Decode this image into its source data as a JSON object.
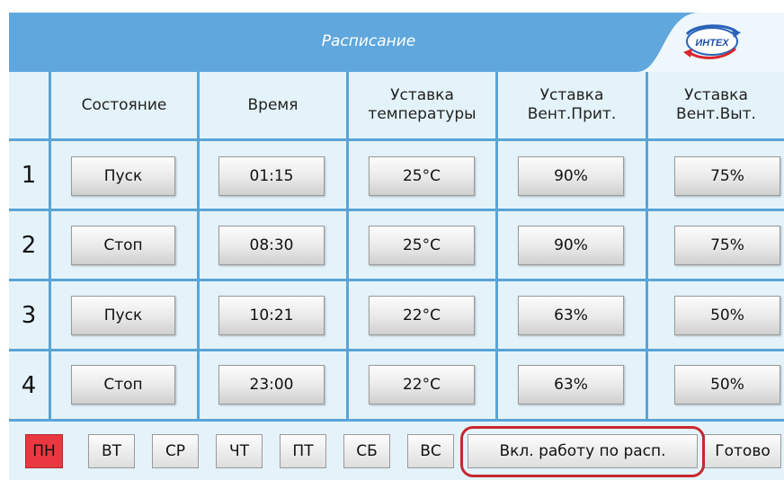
{
  "title": "Расписание",
  "logo_text": "ИНТЕХ",
  "headers": [
    "Состояние",
    "Время",
    "Уставка температуры",
    "Уставка Вент.Прит.",
    "Уставка Вент.Выт."
  ],
  "headers_lines": [
    [
      "Состояние"
    ],
    [
      "Время"
    ],
    [
      "Уставка",
      "температуры"
    ],
    [
      "Уставка",
      "Вент.Прит."
    ],
    [
      "Уставка",
      "Вент.Выт."
    ]
  ],
  "rows": [
    {
      "num": "1",
      "state": "Пуск",
      "time": "01:15",
      "temp": "25°C",
      "supply": "90%",
      "exhaust": "75%"
    },
    {
      "num": "2",
      "state": "Стоп",
      "time": "08:30",
      "temp": "25°C",
      "supply": "90%",
      "exhaust": "75%"
    },
    {
      "num": "3",
      "state": "Пуск",
      "time": "10:21",
      "temp": "22°C",
      "supply": "63%",
      "exhaust": "50%"
    },
    {
      "num": "4",
      "state": "Стоп",
      "time": "23:00",
      "temp": "22°C",
      "supply": "63%",
      "exhaust": "50%"
    }
  ],
  "days": [
    "ПН",
    "ВТ",
    "СР",
    "ЧТ",
    "ПТ",
    "СБ",
    "ВС"
  ],
  "active_day": "ПН",
  "enable_schedule_label": "Вкл. работу по расп.",
  "done_label": "Готово",
  "colors": {
    "title_bar": "#5fa7dd",
    "background": "#e4f3fa",
    "grid": "#59a4d6",
    "active_day": "#e9383f",
    "highlight": "#c8272f"
  }
}
